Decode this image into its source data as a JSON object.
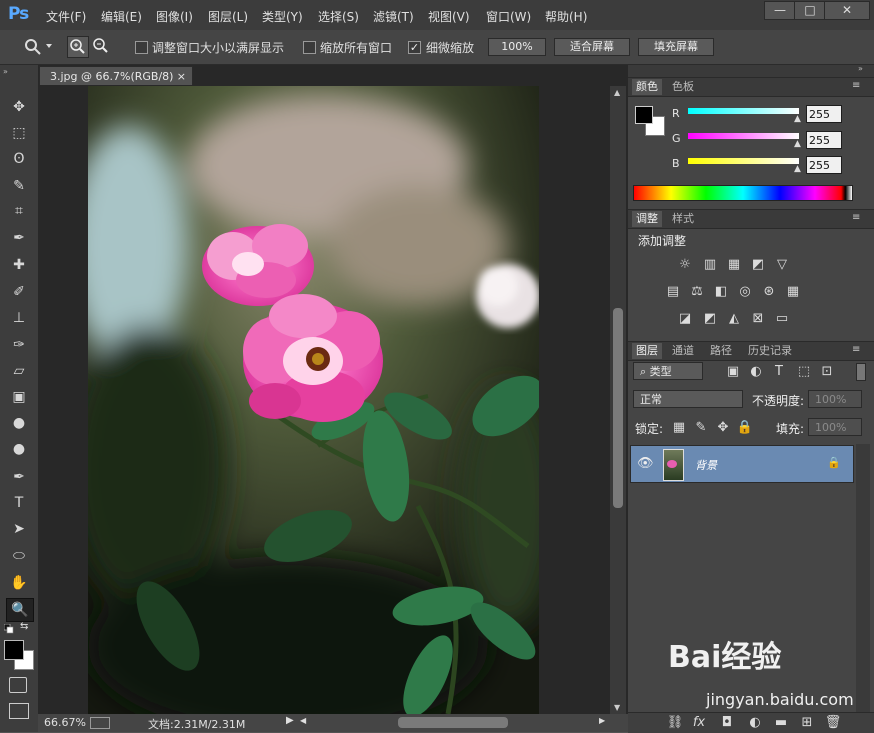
{
  "app": {
    "logo": "Ps"
  },
  "menu": [
    "文件(F)",
    "编辑(E)",
    "图像(I)",
    "图层(L)",
    "类型(Y)",
    "选择(S)",
    "滤镜(T)",
    "视图(V)",
    "窗口(W)",
    "帮助(H)"
  ],
  "window_controls": {
    "minimize": "—",
    "maximize": "□",
    "close": "✕"
  },
  "options_bar": {
    "resize_windows_label": "调整窗口大小以满屏显示",
    "resize_windows_checked": false,
    "zoom_all_label": "缩放所有窗口",
    "zoom_all_checked": false,
    "scrubby_zoom_label": "细微缩放",
    "scrubby_zoom_checked": true,
    "btn_100": "100%",
    "btn_fit": "适合屏幕",
    "btn_fill": "填充屏幕",
    "checkmark": "✓"
  },
  "tools": [
    "move-tool",
    "marquee-tool",
    "lasso-tool",
    "quick-select-tool",
    "crop-tool",
    "eyedropper-tool",
    "healing-brush-tool",
    "brush-tool",
    "clone-stamp-tool",
    "history-brush-tool",
    "eraser-tool",
    "gradient-tool",
    "blur-tool",
    "dodge-tool",
    "pen-tool",
    "type-tool",
    "path-select-tool",
    "ellipse-tool",
    "hand-tool",
    "zoom-tool"
  ],
  "tool_glyphs": [
    "✥",
    "⬚",
    "ʘ",
    "✎",
    "⌗",
    "✒",
    "✚",
    "✐",
    "⊥",
    "✑",
    "▱",
    "▣",
    "●",
    "●",
    "✒",
    "T",
    "➤",
    "⬭",
    "✋",
    "🔍"
  ],
  "document": {
    "tab_title": "3.jpg @ 66.7%(RGB/8)",
    "tab_close": "×"
  },
  "status": {
    "zoom": "66.67%",
    "doc_info": "文档:2.31M/2.31M"
  },
  "color_panel": {
    "tabs": [
      "颜色",
      "色板"
    ],
    "channels": [
      {
        "label": "R",
        "value": "255"
      },
      {
        "label": "G",
        "value": "255"
      },
      {
        "label": "B",
        "value": "255"
      }
    ],
    "colors": {
      "r": "#3fe4e4",
      "g": "#e04fe0",
      "b": "#e8e84a"
    }
  },
  "adjustments_panel": {
    "tabs": [
      "调整",
      "样式"
    ],
    "title": "添加调整"
  },
  "layers_panel": {
    "tabs": [
      "图层",
      "通道",
      "路径",
      "历史记录"
    ],
    "filter_kind": "类型",
    "blend_mode": "正常",
    "opacity_label": "不透明度:",
    "opacity_value": "100%",
    "lock_label": "锁定:",
    "fill_label": "填充:",
    "fill_value": "100%",
    "layers": [
      {
        "name": "背景",
        "visible": true,
        "locked": true
      }
    ]
  },
  "watermark": {
    "brand": "Bai经验",
    "url": "jingyan.baidu.com"
  }
}
